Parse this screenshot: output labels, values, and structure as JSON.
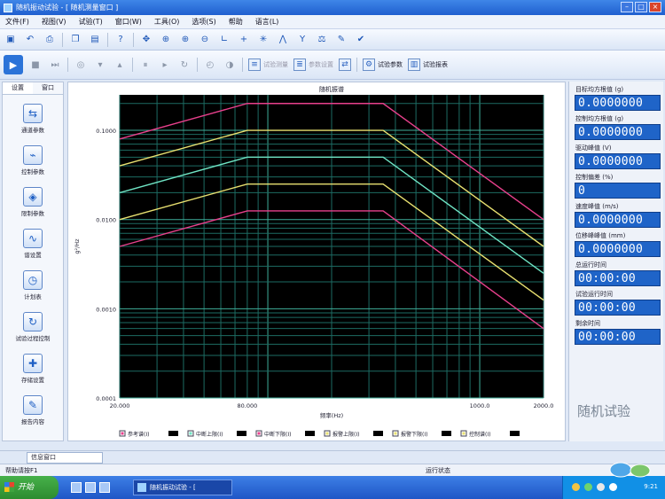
{
  "window": {
    "title": "随机振动试验 - [ 随机测量窗口 ]"
  },
  "menu": [
    "文件(F)",
    "视图(V)",
    "试验(T)",
    "窗口(W)",
    "工具(O)",
    "选项(S)",
    "帮助",
    "语言(L)"
  ],
  "toolbar2": {
    "analysis": "试验测量",
    "params": "参数设置",
    "btn_a": "试验参数",
    "btn_b": "试验报表"
  },
  "leftpanel": {
    "tabs": [
      "设置",
      "窗口"
    ],
    "items": [
      "通道参数",
      "控制参数",
      "限制参数",
      "谱设置",
      "计划表",
      "试验过程控制",
      "存储设置",
      "报告内容"
    ]
  },
  "chart": {
    "title": "随机振谱",
    "xlabel": "频率(Hz)",
    "ylabel": "g²/Hz",
    "xticks": [
      "20.000",
      "80.000",
      "1000.0",
      "2000.0"
    ],
    "yticks": [
      "0.1000",
      "0.0100",
      "0.0010",
      "0.0001"
    ],
    "legend": [
      "参考谱(I)",
      "中断上限(I)",
      "中断下限(I)",
      "报警上限(I)",
      "报警下限(I)",
      "控制谱(I)"
    ]
  },
  "chart_data": {
    "type": "line",
    "xscale": "log",
    "yscale": "log",
    "xlim": [
      20,
      2000
    ],
    "ylim": [
      0.0001,
      0.25
    ],
    "x": [
      20,
      80,
      350,
      2000
    ],
    "series": [
      {
        "name": "中断上限(I)",
        "values": [
          0.08,
          0.2,
          0.2,
          0.01
        ],
        "color": "#e8408c"
      },
      {
        "name": "报警上限(I)",
        "values": [
          0.04,
          0.1,
          0.1,
          0.005
        ],
        "color": "#e8e070"
      },
      {
        "name": "参考谱(I)",
        "values": [
          0.02,
          0.05,
          0.05,
          0.0025
        ],
        "color": "#6fe4c4"
      },
      {
        "name": "报警下限(I)",
        "values": [
          0.01,
          0.025,
          0.025,
          0.00125
        ],
        "color": "#e8e070"
      },
      {
        "name": "中断下限(I)",
        "values": [
          0.005,
          0.0125,
          0.0125,
          0.0006
        ],
        "color": "#e8408c"
      }
    ],
    "grid": true,
    "legend_position": "bottom"
  },
  "rightpanel": {
    "fields": [
      {
        "label": "目标均方根值 (g)",
        "value": "0.0000000"
      },
      {
        "label": "控制均方根值 (g)",
        "value": "0.0000000"
      },
      {
        "label": "驱动峰值 (V)",
        "value": "0.0000000"
      },
      {
        "label": "控制偏差 (%)",
        "value": "0"
      },
      {
        "label": "速度峰值 (m/s)",
        "value": "0.0000000"
      },
      {
        "label": "位移峰峰值 (mm)",
        "value": "0.0000000"
      },
      {
        "label": "总运行时间",
        "value": "00:00:00"
      },
      {
        "label": "试验运行时间",
        "value": "00:00:00"
      },
      {
        "label": "剩余时间",
        "value": "00:00:00"
      }
    ],
    "watermark": "随机试验"
  },
  "bottom": {
    "tab": "信息窗口",
    "status_left": "帮助请按F1",
    "status_mid": "运行状态"
  },
  "taskbar": {
    "start": "开始",
    "app": "随机振动试验 - [",
    "clock": "9:21"
  }
}
